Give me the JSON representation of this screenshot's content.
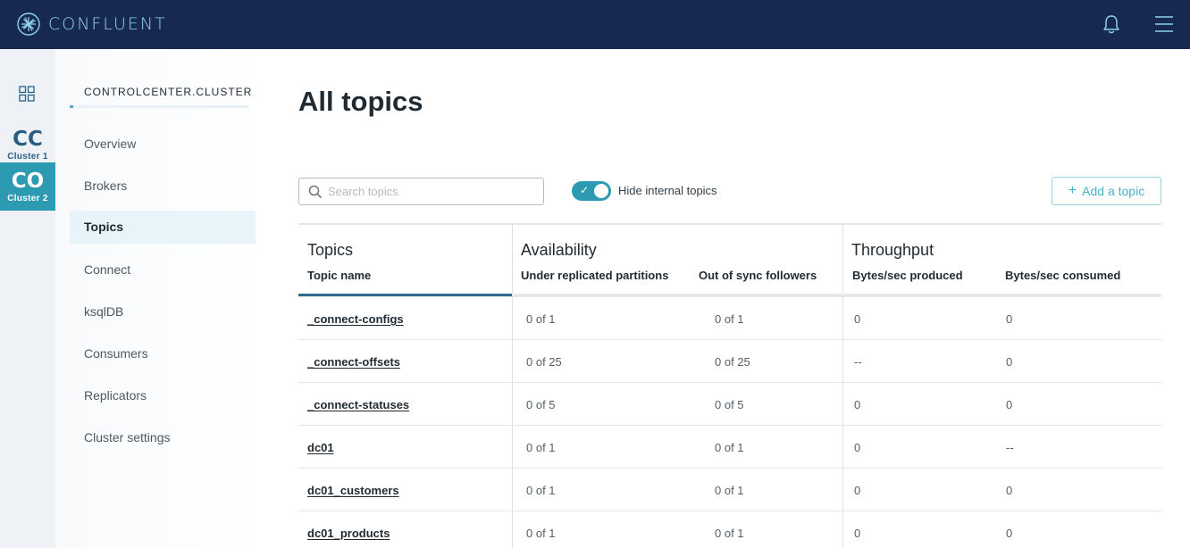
{
  "header": {
    "brand": "CONFLUENT",
    "icons": {
      "logo": "confluent-logo-icon",
      "notifications": "bell-icon",
      "menu": "hamburger-menu-icon"
    },
    "background": "#172951"
  },
  "rail": {
    "grid_icon": "grid-icon",
    "clusters": [
      {
        "abbr": "CC",
        "label": "Cluster 1"
      },
      {
        "abbr": "CO",
        "label": "Cluster 2"
      }
    ]
  },
  "sidebar": {
    "cluster_name": "CONTROLCENTER.CLUSTER",
    "items": [
      {
        "label": "Overview"
      },
      {
        "label": "Brokers"
      },
      {
        "label": "Topics"
      },
      {
        "label": "Connect"
      },
      {
        "label": "ksqlDB"
      },
      {
        "label": "Consumers"
      },
      {
        "label": "Replicators"
      },
      {
        "label": "Cluster settings"
      }
    ],
    "active": "Topics"
  },
  "main": {
    "title": "All topics",
    "search": {
      "placeholder": "Search topics",
      "value": ""
    },
    "toggle": {
      "label": "Hide internal topics",
      "checked": true
    },
    "add_button": "Add a topic",
    "accent": "#2c9bb1"
  },
  "table": {
    "groups": [
      "Topics",
      "Availability",
      "Throughput"
    ],
    "columns": [
      "Topic name",
      "Under replicated partitions",
      "Out of sync followers",
      "Bytes/sec produced",
      "Bytes/sec consumed"
    ],
    "rows": [
      [
        "_connect-configs",
        "0 of 1",
        "0 of 1",
        "0",
        "0"
      ],
      [
        "_connect-offsets",
        "0 of 25",
        "0 of 25",
        "--",
        "0"
      ],
      [
        "_connect-statuses",
        "0 of 5",
        "0 of 5",
        "0",
        "0"
      ],
      [
        "dc01",
        "0 of 1",
        "0 of 1",
        "0",
        "--"
      ],
      [
        "dc01_customers",
        "0 of 1",
        "0 of 1",
        "0",
        "0"
      ],
      [
        "dc01_products",
        "0 of 1",
        "0 of 1",
        "0",
        "0"
      ]
    ]
  }
}
